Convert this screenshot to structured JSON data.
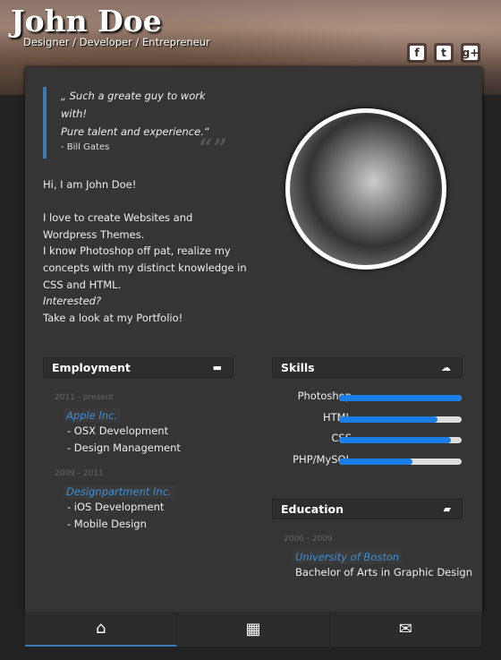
{
  "header": {
    "name": "John Doe",
    "tagline": "Designer / Developer / Entrepreneur",
    "social": [
      {
        "icon": "facebook-icon",
        "glyph": "f"
      },
      {
        "icon": "twitter-icon",
        "glyph": "t"
      },
      {
        "icon": "google-plus-icon",
        "glyph": "g+"
      }
    ]
  },
  "quote": {
    "line1": "„ Such a greate guy to work with!",
    "line2": "Pure talent and experience.“",
    "author": "- Bill Gates",
    "mark": "“”"
  },
  "intro": [
    "Hi, I am John Doe!",
    "",
    "I love to create Websites and",
    "Wordpress Themes.",
    "I know Photoshop off pat, realize my",
    "concepts with my distinct knowledge in",
    "CSS and HTML.",
    "Interested?",
    "Take a look at my Portfolio!"
  ],
  "employment": {
    "title": "Employment",
    "jobs": [
      {
        "years": "2011 - present",
        "company": "Apple Inc.",
        "items": [
          "- OSX Development",
          "- Design Management"
        ]
      },
      {
        "years": "2009 - 2011",
        "company": "Designpartment Inc.",
        "items": [
          "- iOS Development",
          "- Mobile Design"
        ]
      }
    ]
  },
  "skills": {
    "title": "Skills",
    "items": [
      {
        "name": "Photoshop",
        "level": 100
      },
      {
        "name": "HTML",
        "level": 80
      },
      {
        "name": "CSS",
        "level": 91
      },
      {
        "name": "PHP/MySQL",
        "level": 60
      }
    ],
    "color": "#1a7ee6"
  },
  "education": {
    "title": "Education",
    "years": "2006 - 2009",
    "school": "University of Boston",
    "degree": "Bachelor of Arts in Graphic Design"
  },
  "nav": [
    {
      "icon": "home-icon",
      "glyph": "⌂",
      "active": true
    },
    {
      "icon": "grid-icon",
      "glyph": "▦"
    },
    {
      "icon": "mail-icon",
      "glyph": "✉"
    }
  ],
  "accent": "#3d7ab5"
}
